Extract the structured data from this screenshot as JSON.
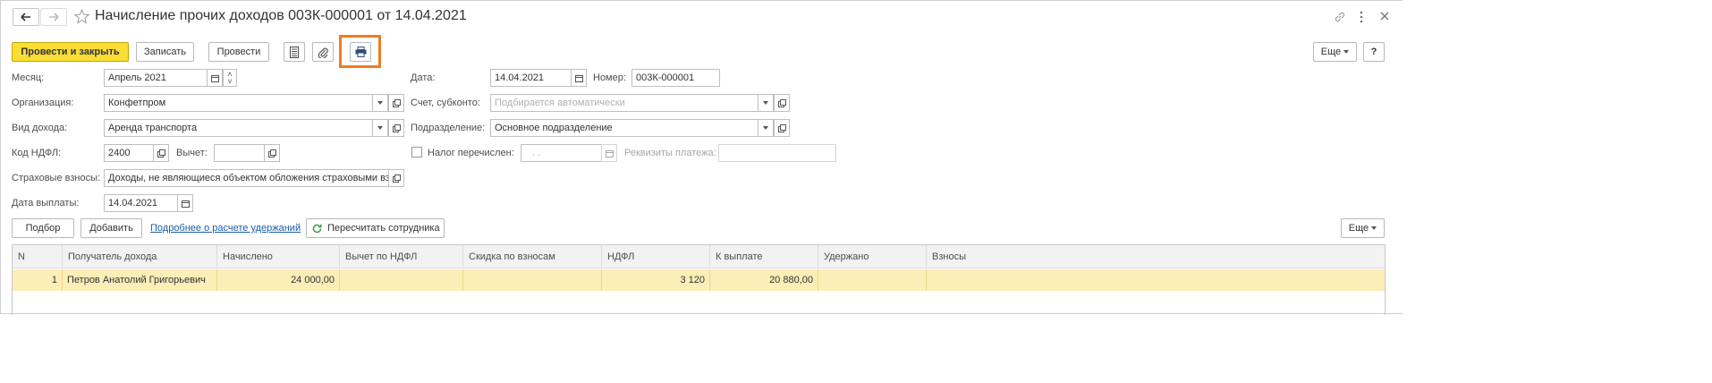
{
  "window": {
    "title": "Начисление прочих доходов 003К-000001 от 14.04.2021"
  },
  "toolbar": {
    "post_and_close": "Провести и закрыть",
    "save": "Записать",
    "post": "Провести",
    "more": "Еще",
    "help": "?"
  },
  "form": {
    "month_label": "Месяц:",
    "month_value": "Апрель 2021",
    "date_label": "Дата:",
    "date_value": "14.04.2021",
    "number_label": "Номер:",
    "number_value": "003К-000001",
    "org_label": "Организация:",
    "org_value": "Конфетпром",
    "account_label": "Счет, субконто:",
    "account_placeholder": "Подбирается автоматически",
    "income_type_label": "Вид дохода:",
    "income_type_value": "Аренда транспорта",
    "department_label": "Подразделение:",
    "department_value": "Основное подразделение",
    "ndfl_code_label": "Код НДФЛ:",
    "ndfl_code_value": "2400",
    "deduction_label": "Вычет:",
    "deduction_value": "",
    "tax_paid_label": "Налог перечислен:",
    "tax_paid_date": ". .",
    "payment_details_label": "Реквизиты платежа:",
    "payment_details_value": "",
    "insurance_label": "Страховые взносы:",
    "insurance_value": "Доходы, не являющиеся объектом обложения страховыми взн",
    "pay_date_label": "Дата выплаты:",
    "pay_date_value": "14.04.2021"
  },
  "table_toolbar": {
    "select": "Подбор",
    "add": "Добавить",
    "details_link": "Подробнее о расчете удержаний",
    "recalc": "Пересчитать сотрудника",
    "more": "Еще"
  },
  "table": {
    "columns": [
      "N",
      "Получатель дохода",
      "Начислено",
      "Вычет по НДФЛ",
      "Скидка по взносам",
      "НДФЛ",
      "К выплате",
      "Удержано",
      "Взносы"
    ],
    "rows": [
      {
        "n": "1",
        "recipient": "Петров Анатолий Григорьевич",
        "accrued": "24 000,00",
        "deduction": "",
        "discount": "",
        "ndfl": "3 120",
        "to_pay": "20 880,00",
        "withheld": "",
        "contributions": ""
      }
    ]
  },
  "colors": {
    "primary_button": "#fadd35",
    "row_highlight": "#fbeeb6",
    "highlight_frame": "#f07c22",
    "link": "#1a5ea8"
  }
}
